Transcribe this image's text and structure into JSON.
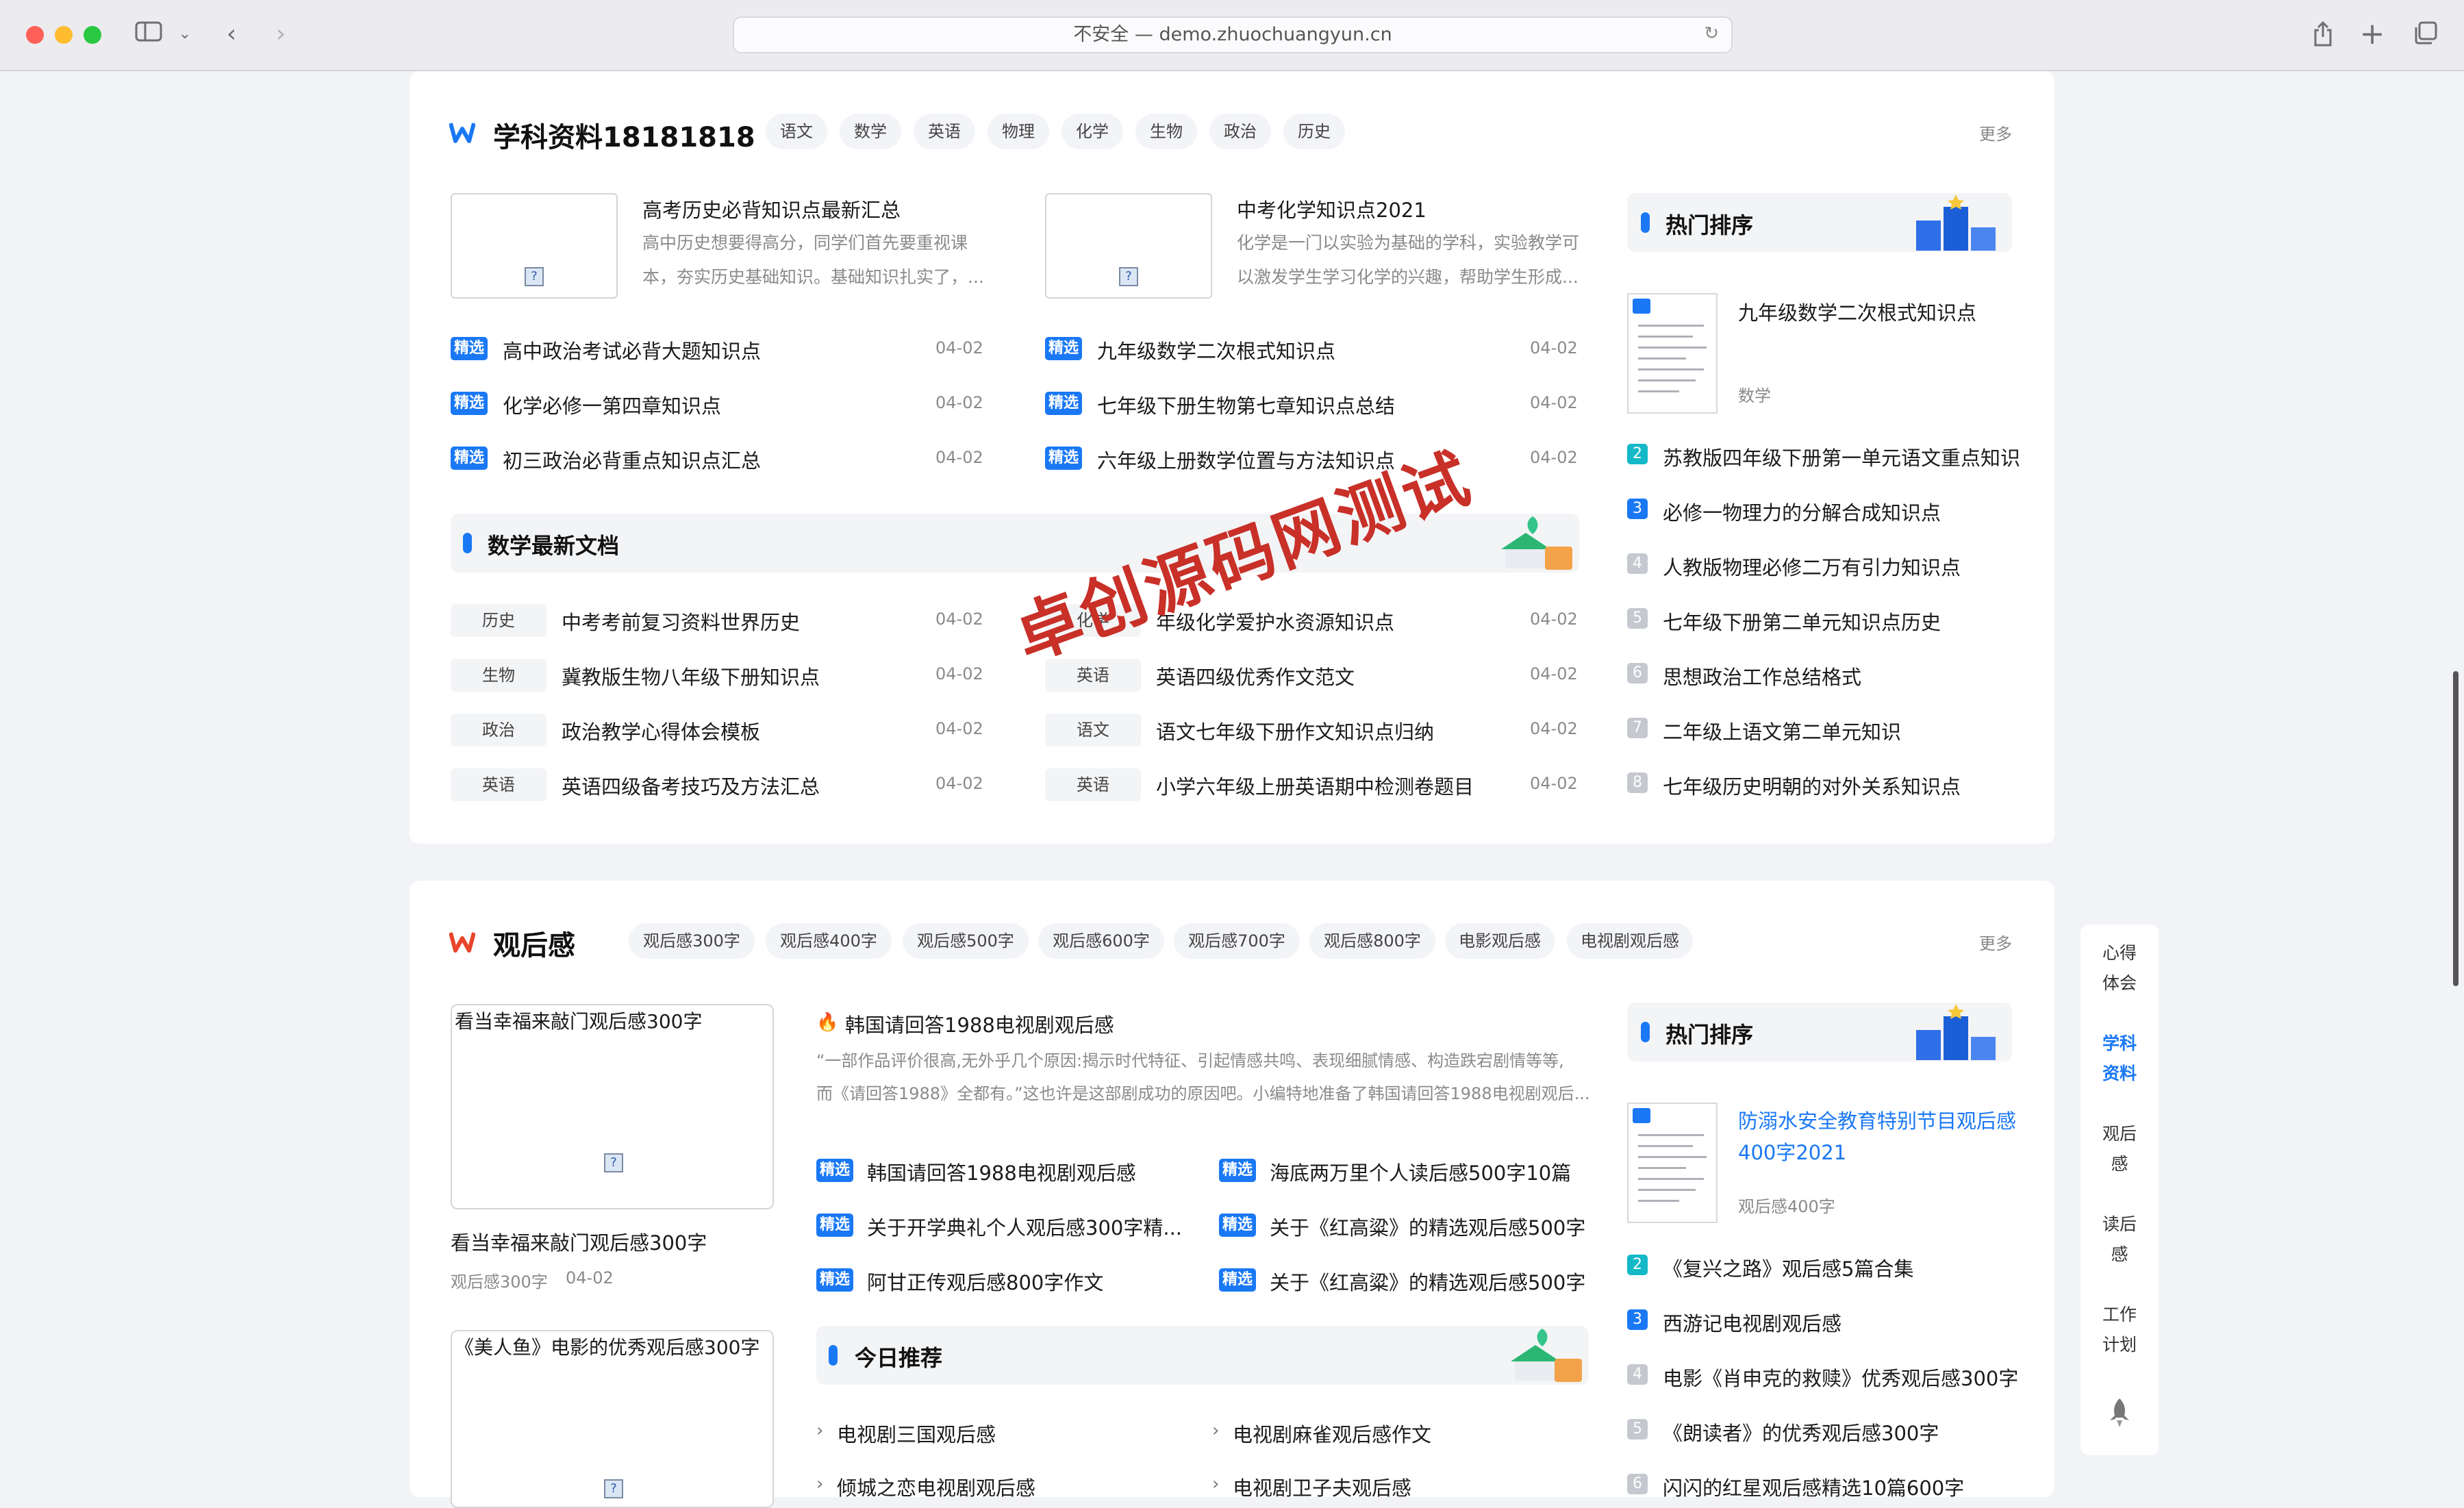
{
  "browser": {
    "address": "不安全 — demo.zhuochuangyun.cn"
  },
  "subject": {
    "title": "学科资料18181818",
    "tags": [
      "语文",
      "数学",
      "英语",
      "物理",
      "化学",
      "生物",
      "政治",
      "历史"
    ],
    "more": "更多",
    "feature1": {
      "title": "高考历史必背知识点最新汇总",
      "desc1": "高中历史想要得高分，同学们首先要重视课",
      "desc2": "本，夯实历史基础知识。基础知识扎实了，..."
    },
    "feature2": {
      "title": "中考化学知识点2021",
      "desc1": "化学是一门以实验为基础的学科，实验教学可",
      "desc2": "以激发学生学习化学的兴趣，帮助学生形成..."
    },
    "badge": "精选",
    "left_list": [
      {
        "t": "高中政治考试必背大题知识点",
        "d": "04-02"
      },
      {
        "t": "化学必修一第四章知识点",
        "d": "04-02"
      },
      {
        "t": "初三政治必背重点知识点汇总",
        "d": "04-02"
      }
    ],
    "right_list": [
      {
        "t": "九年级数学二次根式知识点",
        "d": "04-02"
      },
      {
        "t": "七年级下册生物第七章知识点总结",
        "d": "04-02"
      },
      {
        "t": "六年级上册数学位置与方法知识点",
        "d": "04-02"
      }
    ],
    "math_bar": "数学最新文档",
    "cat_left": [
      {
        "c": "历史",
        "t": "中考考前复习资料世界历史",
        "d": "04-02"
      },
      {
        "c": "生物",
        "t": "冀教版生物八年级下册知识点",
        "d": "04-02"
      },
      {
        "c": "政治",
        "t": "政治教学心得体会模板",
        "d": "04-02"
      },
      {
        "c": "英语",
        "t": "英语四级备考技巧及方法汇总",
        "d": "04-02"
      }
    ],
    "cat_right": [
      {
        "c": "化学",
        "t": "年级化学爱护水资源知识点",
        "d": "04-02"
      },
      {
        "c": "英语",
        "t": "英语四级优秀作文范文",
        "d": "04-02"
      },
      {
        "c": "语文",
        "t": "语文七年级下册作文知识点归纳",
        "d": "04-02"
      },
      {
        "c": "英语",
        "t": "小学六年级上册英语期中检测卷题目",
        "d": "04-02"
      }
    ],
    "hot": {
      "title": "热门排序",
      "top": {
        "t": "九年级数学二次根式知识点",
        "cat": "数学"
      },
      "items": [
        "苏教版四年级下册第一单元语文重点知识",
        "必修一物理力的分解合成知识点",
        "人教版物理必修二万有引力知识点",
        "七年级下册第二单元知识点历史",
        "思想政治工作总结格式",
        "二年级上语文第二单元知识",
        "七年级历史明朝的对外关系知识点"
      ]
    }
  },
  "watermark": "卓创源码网测试",
  "review": {
    "title": "观后感",
    "tags": [
      "观后感300字",
      "观后感400字",
      "观后感500字",
      "观后感600字",
      "观后感700字",
      "观后感800字",
      "电影观后感",
      "电视剧观后感"
    ],
    "more": "更多",
    "card1": {
      "alt": "看当幸福来敲门观后感300字",
      "title": "看当幸福来敲门观后感300字",
      "cat": "观后感300字",
      "date": "04-02"
    },
    "card2": {
      "alt": "《美人鱼》电影的优秀观后感300字"
    },
    "headline": {
      "t": "韩国请回答1988电视剧观后感",
      "d1": "“一部作品评价很高,无外乎几个原因:揭示时代特征、引起情感共鸣、表现细腻情感、构造跌宕剧情等等,",
      "d2": "而《请回答1988》全都有。”这也许是这部剧成功的原因吧。小编特地准备了韩国请回答1988电视剧观后..."
    },
    "left_list": [
      "韩国请回答1988电视剧观后感",
      "关于开学典礼个人观后感300字精...",
      "阿甘正传观后感800字作文"
    ],
    "right_list": [
      "海底两万里个人读后感500字10篇",
      "关于《红高粱》的精选观后感500字",
      "关于《红高粱》的精选观后感500字"
    ],
    "today": "今日推荐",
    "today_left": [
      "电视剧三国观后感",
      "倾城之恋电视剧观后感"
    ],
    "today_right": [
      "电视剧麻雀观后感作文",
      "电视剧卫子夫观后感"
    ],
    "hot": {
      "title": "热门排序",
      "top": {
        "t1": "防溺水安全教育特别节目观后感",
        "t2": "400字2021",
        "cat": "观后感400字"
      },
      "items": [
        "《复兴之路》观后感5篇合集",
        "西游记电视剧观后感",
        "电影《肖申克的救赎》优秀观后感300字",
        "《朗读者》的优秀观后感300字",
        "闪闪的红星观后感精选10篇600字"
      ]
    }
  },
  "side_nav": [
    [
      "心得",
      "体会"
    ],
    [
      "学科",
      "资料"
    ],
    [
      "观后",
      "感"
    ],
    [
      "读后",
      "感"
    ],
    [
      "工作",
      "计划"
    ]
  ],
  "colors": {
    "accent": "#1a78f5",
    "watermark": "#c83028",
    "card": "#ffffff",
    "bg": "#f2f3f7"
  }
}
